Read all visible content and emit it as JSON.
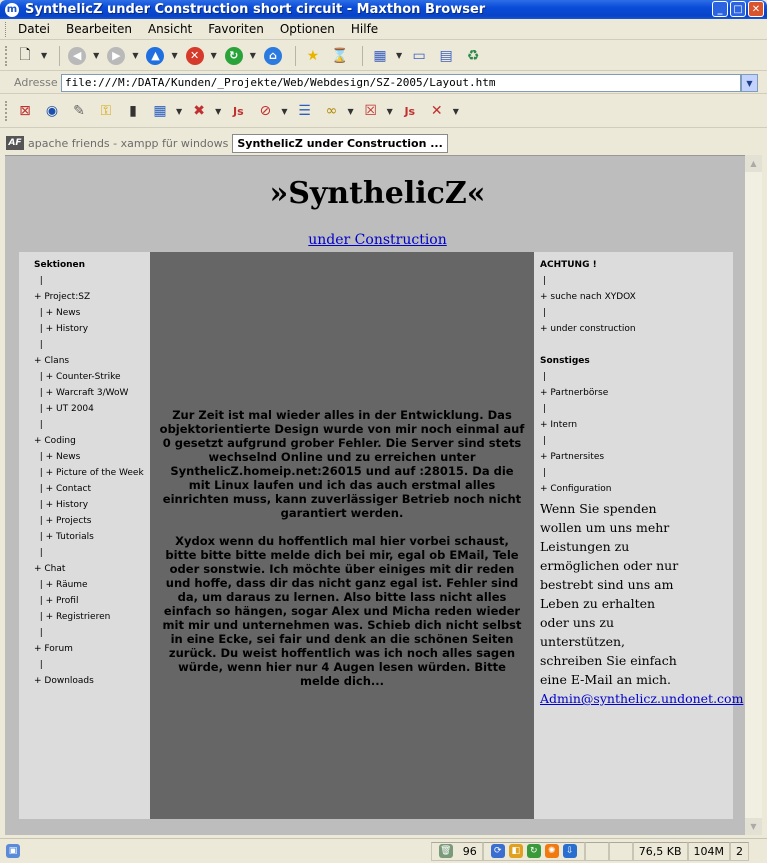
{
  "window": {
    "title": "SynthelicZ under Construction short circuit - Maxthon Browser"
  },
  "menu": [
    "Datei",
    "Bearbeiten",
    "Ansicht",
    "Favoriten",
    "Optionen",
    "Hilfe"
  ],
  "address": {
    "label": "Adresse",
    "value": "file:///M:/DATA/Kunden/_Projekte/Web/Webdesign/SZ-2005/Layout.htm"
  },
  "tabs": {
    "inactive_label": "apache friends - xampp für windows",
    "active_label": "SynthelicZ under Construction ..."
  },
  "page": {
    "title": "»SynthelicZ«",
    "subtitle_link": "under Construction",
    "left_nav": [
      {
        "text": "Sektionen",
        "bold": true
      },
      {
        "text": "  |"
      },
      {
        "text": "+ Project:SZ"
      },
      {
        "text": "  | + News"
      },
      {
        "text": "  | + History"
      },
      {
        "text": "  |"
      },
      {
        "text": "+ Clans"
      },
      {
        "text": "  | + Counter-Strike"
      },
      {
        "text": "  | + Warcraft 3/WoW"
      },
      {
        "text": "  | + UT 2004"
      },
      {
        "text": "  |"
      },
      {
        "text": "+ Coding"
      },
      {
        "text": "  | + News"
      },
      {
        "text": "  | + Picture of the Week"
      },
      {
        "text": "  | + Contact"
      },
      {
        "text": "  | + History"
      },
      {
        "text": "  | + Projects"
      },
      {
        "text": "  | + Tutorials"
      },
      {
        "text": "  |"
      },
      {
        "text": "+ Chat"
      },
      {
        "text": "  | + Räume"
      },
      {
        "text": "  | + Profil"
      },
      {
        "text": "  | + Registrieren"
      },
      {
        "text": "  |"
      },
      {
        "text": "+ Forum"
      },
      {
        "text": "  |"
      },
      {
        "text": "+ Downloads"
      }
    ],
    "center_paragraphs": [
      "Zur Zeit ist mal wieder alles in der Entwicklung. Das objektorientierte Design wurde von mir noch einmal auf 0 gesetzt aufgrund grober Fehler. Die Server sind stets wechselnd Online und zu erreichen unter SynthelicZ.homeip.net:26015 und auf :28015. Da die mit Linux laufen und ich das auch erstmal alles einrichten muss, kann zuverlässiger Betrieb noch nicht garantiert werden.",
      "Xydox wenn du hoffentlich mal hier vorbei schaust, bitte bitte bitte melde dich bei mir, egal ob EMail, Tele oder sonstwie. Ich möchte über einiges mit dir reden und hoffe, dass dir das nicht ganz egal ist. Fehler sind da, um daraus zu lernen. Also bitte lass nicht alles einfach so hängen, sogar Alex und Micha reden wieder mit mir und unternehmen was. Schieb dich nicht selbst in eine Ecke, sei fair und denk an die schönen Seiten zurück. Du weist hoffentlich was ich noch alles sagen würde, wenn hier nur 4 Augen lesen würden. Bitte melde dich..."
    ],
    "right_nav": [
      {
        "text": "ACHTUNG !",
        "bold": true
      },
      {
        "text": " |"
      },
      {
        "text": "+ suche nach XYDOX"
      },
      {
        "text": " |"
      },
      {
        "text": "+ under construction"
      },
      {
        "text": ""
      },
      {
        "text": "Sonstiges",
        "bold": true
      },
      {
        "text": " |"
      },
      {
        "text": "+ Partnerbörse"
      },
      {
        "text": " |"
      },
      {
        "text": "+ Intern"
      },
      {
        "text": " |"
      },
      {
        "text": "+ Partnersites"
      },
      {
        "text": " |"
      },
      {
        "text": "+ Configuration"
      }
    ],
    "donate_lines": [
      "Wenn Sie spenden",
      "wollen um uns mehr",
      "Leistungen zu",
      "ermöglichen oder nur",
      "bestrebt sind uns am",
      "Leben zu erhalten",
      "oder uns zu",
      "unterstützen,",
      "schreiben Sie einfach",
      "eine E-Mail an mich."
    ],
    "donate_email": "Admin@synthelicz.undonet.com"
  },
  "status": {
    "count": "96",
    "size": "76,5 KB",
    "memory": "104M",
    "tabs_open": "2"
  },
  "colors": {
    "titlebar": "#0a4bd8",
    "page_bg": "#bdbdbd",
    "side_bg": "#dcdcdc",
    "center_bg": "#666666",
    "link": "#0000cc"
  }
}
